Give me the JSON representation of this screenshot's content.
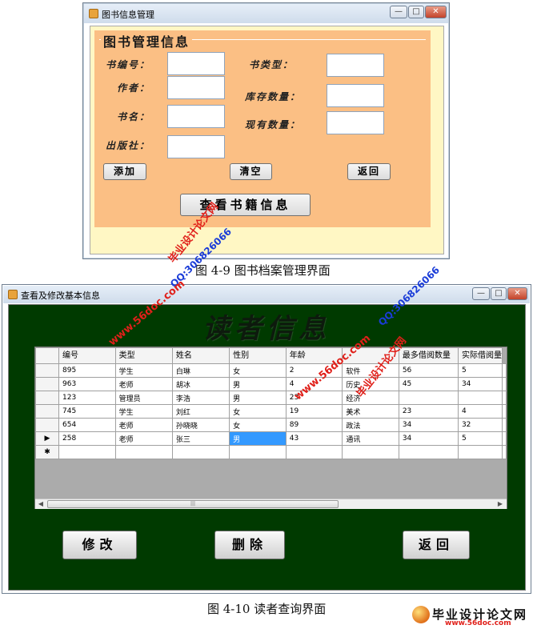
{
  "window1": {
    "title": "图书信息管理",
    "group_title": "图书管理信息",
    "labels": {
      "book_id": "书编号：",
      "author": "作者：",
      "book_name": "书名：",
      "publisher": "出版社：",
      "book_type": "书类型：",
      "stock_qty": "库存数量：",
      "current_qty": "现有数量："
    },
    "buttons": {
      "add": "添加",
      "clear": "清空",
      "back": "返回",
      "view_books": "查看书籍信息"
    },
    "caption": "图 4-9 图书档案管理界面"
  },
  "window2": {
    "title": "查看及修改基本信息",
    "heading": "读者信息",
    "grid": {
      "columns": [
        "编号",
        "类型",
        "姓名",
        "性别",
        "年龄",
        "",
        "最多借阅数量",
        "实际借阅量"
      ],
      "rows": [
        [
          "895",
          "学生",
          "白琳",
          "女",
          "2",
          "软件",
          "56",
          "5"
        ],
        [
          "963",
          "老师",
          "胡冰",
          "男",
          "4",
          "历史",
          "45",
          "34"
        ],
        [
          "123",
          "管理员",
          "李浩",
          "男",
          "23",
          "经济",
          "",
          ""
        ],
        [
          "745",
          "学生",
          "刘红",
          "女",
          "19",
          "美术",
          "23",
          "4"
        ],
        [
          "654",
          "老师",
          "孙晓晓",
          "女",
          "89",
          "政法",
          "34",
          "32"
        ],
        [
          "258",
          "老师",
          "张三",
          "男",
          "43",
          "通讯",
          "34",
          "5"
        ]
      ],
      "current_row_marker": "▶",
      "new_row_marker": "✱",
      "scroll_grip": "|||"
    },
    "buttons": {
      "modify": "修改",
      "delete": "删除",
      "back": "返回"
    },
    "caption": "图 4-10 读者查询界面"
  },
  "window_controls": {
    "minimize": "—",
    "maximize": "□",
    "close": "✕"
  },
  "watermarks": {
    "site_name": "毕业设计论文网",
    "url": "www.56doc.com",
    "qq": "QQ:306826066",
    "footer_logo_name": "毕业设计论文网",
    "footer_logo_url": "www.56doc.com"
  },
  "colors": {
    "form_panel": "#fbbf84",
    "form_background": "#fff7c4",
    "reader_background": "#003a00",
    "grid_background": "#ababab",
    "selection": "#3399ff",
    "watermark_red": "#e0201a",
    "watermark_blue": "#1a3cd8"
  }
}
